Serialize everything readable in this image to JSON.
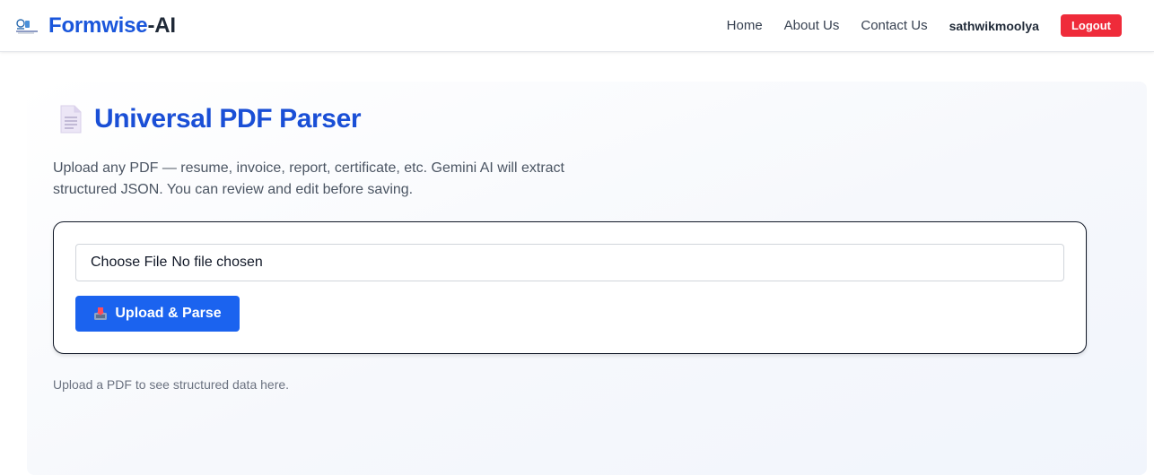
{
  "navbar": {
    "brand_main": "Formwise",
    "brand_accent": "-AI",
    "links": [
      "Home",
      "About Us",
      "Contact Us"
    ],
    "username": "sathwikmoolya",
    "logout_label": "Logout"
  },
  "main": {
    "title": "Universal PDF Parser",
    "description": "Upload any PDF — resume, invoice, report, certificate, etc. Gemini AI will extract structured JSON. You can review and edit before saving.",
    "file_input": {
      "button_label": "Choose File",
      "status": "No file chosen"
    },
    "upload_button_label": "Upload & Parse",
    "hint": "Upload a PDF to see structured data here."
  },
  "icons": {
    "brand": "brand-logo-icon",
    "title": "document-icon",
    "upload": "inbox-tray-icon"
  },
  "colors": {
    "brand_blue": "#1a56db",
    "title_blue": "#1a4fd6",
    "button_blue": "#1b63ef",
    "logout_red": "#ef2b3a"
  }
}
